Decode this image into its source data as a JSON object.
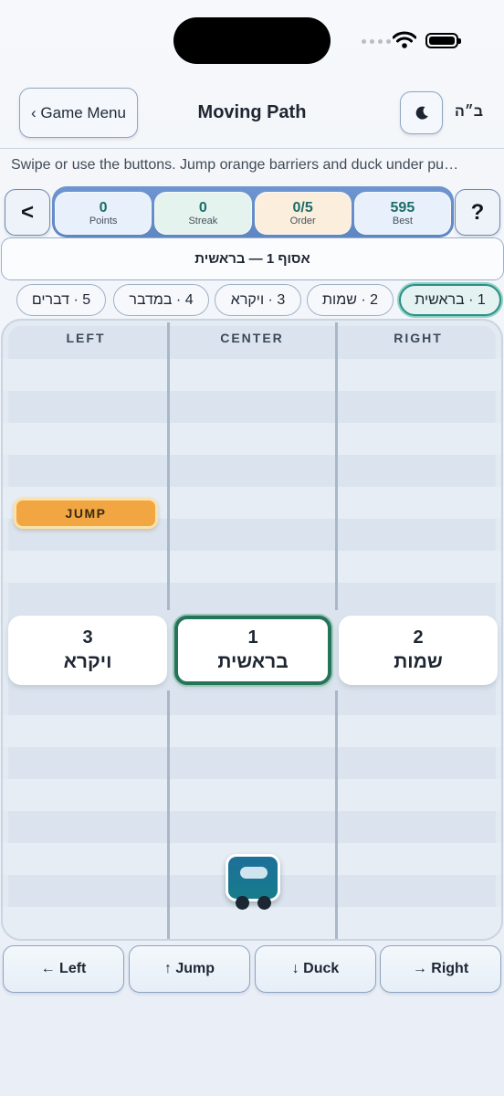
{
  "status": {
    "icons": [
      "signal-dots",
      "wifi-icon",
      "battery-icon"
    ]
  },
  "header": {
    "menu_label": "‹ Game Menu",
    "title": "Moving Path",
    "theme_icon": "moon-icon",
    "bh": "ב״ה"
  },
  "instructions": "Swipe or use the buttons. Jump orange barriers and duck under pu…",
  "stats": {
    "back_label": "<",
    "help_label": "?",
    "points": {
      "value": "0",
      "label": "Points"
    },
    "streak": {
      "value": "0",
      "label": "Streak"
    },
    "order": {
      "value": "0/5",
      "label": "Order"
    },
    "best": {
      "value": "595",
      "label": "Best"
    }
  },
  "set_banner": "אסוף 1 — בראשית",
  "chips": [
    {
      "label": "1 · בראשית",
      "active": true
    },
    {
      "label": "2 · שמות",
      "active": false
    },
    {
      "label": "3 · ויקרא",
      "active": false
    },
    {
      "label": "4 · במדבר",
      "active": false
    },
    {
      "label": "5 · דברים",
      "active": false
    }
  ],
  "track": {
    "lanes": [
      "LEFT",
      "CENTER",
      "RIGHT"
    ],
    "obstacle": "JUMP",
    "cards": [
      {
        "lane": "LEFT",
        "num": "3",
        "name": "ויקרא",
        "active": false
      },
      {
        "lane": "CENTER",
        "num": "1",
        "name": "בראשית",
        "active": true
      },
      {
        "lane": "RIGHT",
        "num": "2",
        "name": "שמות",
        "active": false
      }
    ]
  },
  "controls": {
    "left": "← Left",
    "jump": "↑ Jump",
    "duck": "↓ Duck",
    "right": "→ Right"
  },
  "colors": {
    "accent": "#26735c",
    "obstacle": "#f2a642",
    "stats_bar": "#6e95cf"
  }
}
